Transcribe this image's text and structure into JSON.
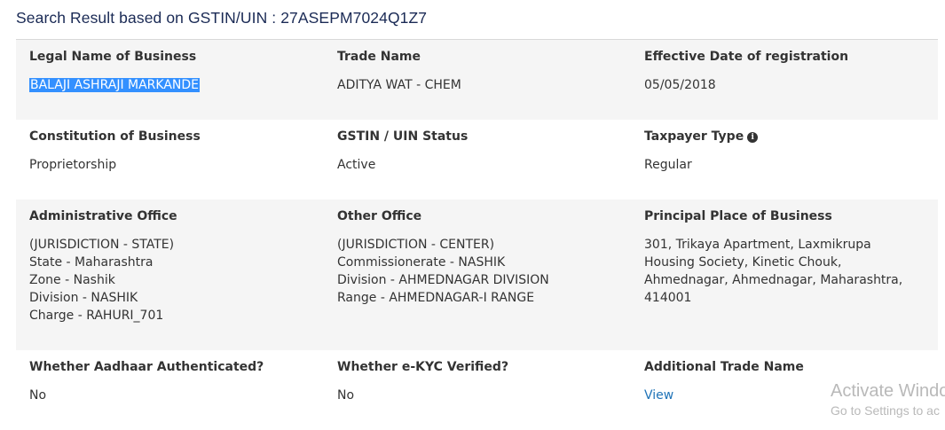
{
  "heading": "Search Result based on GSTIN/UIN : 27ASEPM7024Q1Z7",
  "row1": {
    "legal_name_label": "Legal Name of Business",
    "legal_name_value": "BALAJI ASHRAJI MARKANDE",
    "trade_name_label": "Trade Name",
    "trade_name_value": "ADITYA WAT - CHEM",
    "effective_date_label": "Effective Date of registration",
    "effective_date_value": "05/05/2018"
  },
  "row2": {
    "constitution_label": "Constitution of Business",
    "constitution_value": "Proprietorship",
    "status_label": "GSTIN / UIN Status",
    "status_value": "Active",
    "taxpayer_type_label": "Taxpayer Type",
    "taxpayer_type_value": "Regular",
    "info_icon": "info-circle-icon"
  },
  "row3": {
    "admin_office_label": "Administrative Office",
    "admin_office_lines": [
      "(JURISDICTION - STATE)",
      "State - Maharashtra",
      "Zone - Nashik",
      "Division - NASHIK",
      "Charge - RAHURI_701"
    ],
    "other_office_label": "Other Office",
    "other_office_lines": [
      "(JURISDICTION - CENTER)",
      "Commissionerate - NASHIK",
      "Division - AHMEDNAGAR DIVISION",
      "Range - AHMEDNAGAR-I RANGE"
    ],
    "principal_place_label": "Principal Place of Business",
    "principal_place_lines": [
      "301, Trikaya Apartment, Laxmikrupa",
      "Housing Society, Kinetic Chouk,",
      "Ahmednagar, Ahmednagar, Maharashtra,",
      "414001"
    ]
  },
  "row4": {
    "aadhaar_label": "Whether Aadhaar Authenticated?",
    "aadhaar_value": "No",
    "ekyc_label": "Whether e-KYC Verified?",
    "ekyc_value": "No",
    "additional_trade_label": "Additional Trade Name",
    "additional_trade_link": "View"
  },
  "watermark": {
    "line1": "Activate Windo",
    "line2": "Go to Settings to ac"
  },
  "colors": {
    "heading": "#1a2a55",
    "shade": "#f5f5f5",
    "selection": "#3390ff",
    "link": "#1f73b7"
  }
}
